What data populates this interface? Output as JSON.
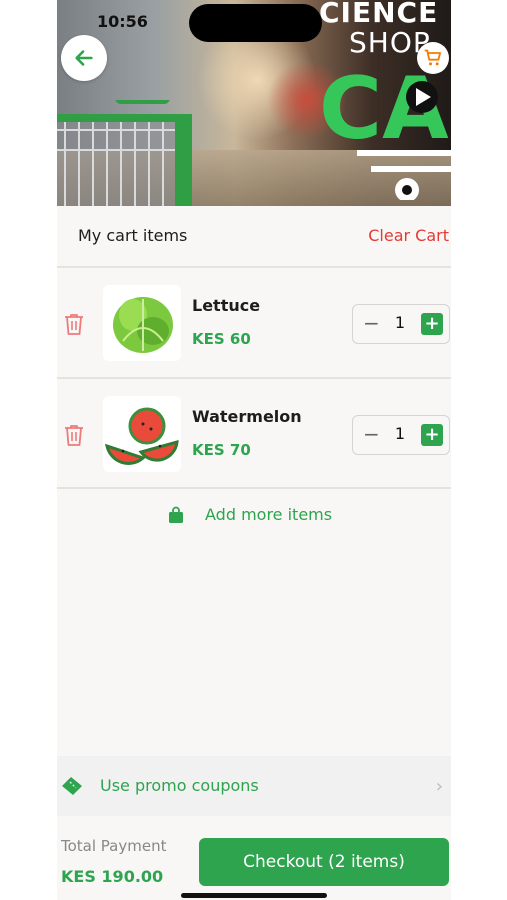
{
  "status_bar": {
    "time": "10:56"
  },
  "hero": {
    "brand_line1": "CIENCE",
    "brand_line2": "SHOP",
    "brand_logo_text": "CA"
  },
  "cart": {
    "title": "My cart items",
    "clear_label": "Clear Cart",
    "items": [
      {
        "name": "Lettuce",
        "price": "KES 60",
        "quantity": "1"
      },
      {
        "name": "Watermelon",
        "price": "KES 70",
        "quantity": "1"
      }
    ],
    "add_more_label": "Add more items"
  },
  "promo": {
    "label": "Use promo coupons"
  },
  "footer": {
    "total_label": "Total Payment",
    "total_amount": "KES 190.00",
    "checkout_label": "Checkout (2 items)"
  },
  "colors": {
    "accent_green": "#2ea44f",
    "danger_red": "#e53935",
    "background": "#f8f7f5"
  },
  "icons": {
    "back": "arrow-left-icon",
    "cart": "shopping-cart-icon",
    "trash": "trash-icon",
    "bag": "shopping-bag-icon",
    "coupon": "ticket-icon",
    "chevron": "chevron-right-icon"
  }
}
